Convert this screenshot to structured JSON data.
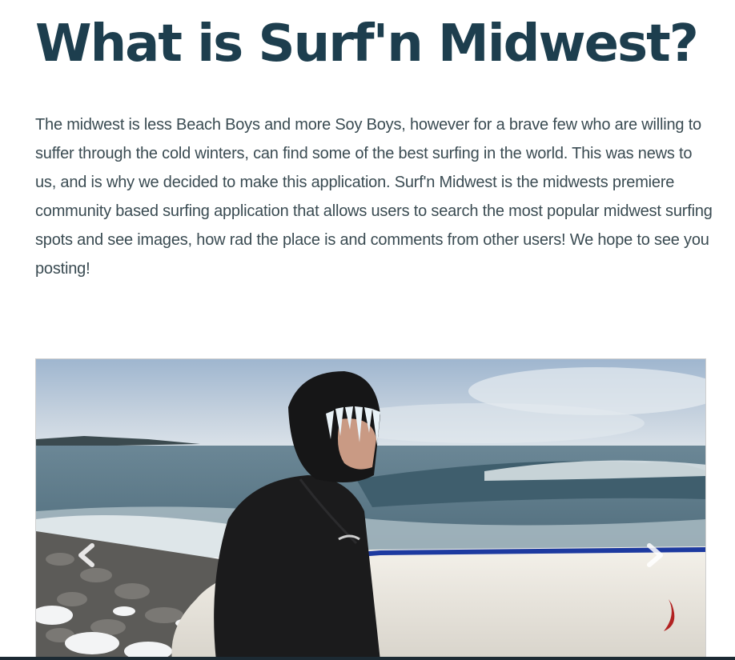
{
  "about": {
    "title": "What is Surf'n Midwest?",
    "description": "The midwest is less Beach Boys and more Soy Boys, however for a brave few who are willing to suffer through the cold winters, can find some of the best surfing in the world. This was news to us, and is why we decided to make this application. Surf'n Midwest is the midwests premiere community based surfing application that allows users to search the most popular midwest surfing spots and see images, how rad the place is and comments from other users! We hope to see you posting!"
  },
  "carousel": {
    "prev_icon": "chevron-left-icon",
    "next_icon": "chevron-right-icon"
  },
  "colors": {
    "heading": "#1d3e4e",
    "body_text": "#3a4b52",
    "bottom_bar": "#1c2a33"
  }
}
